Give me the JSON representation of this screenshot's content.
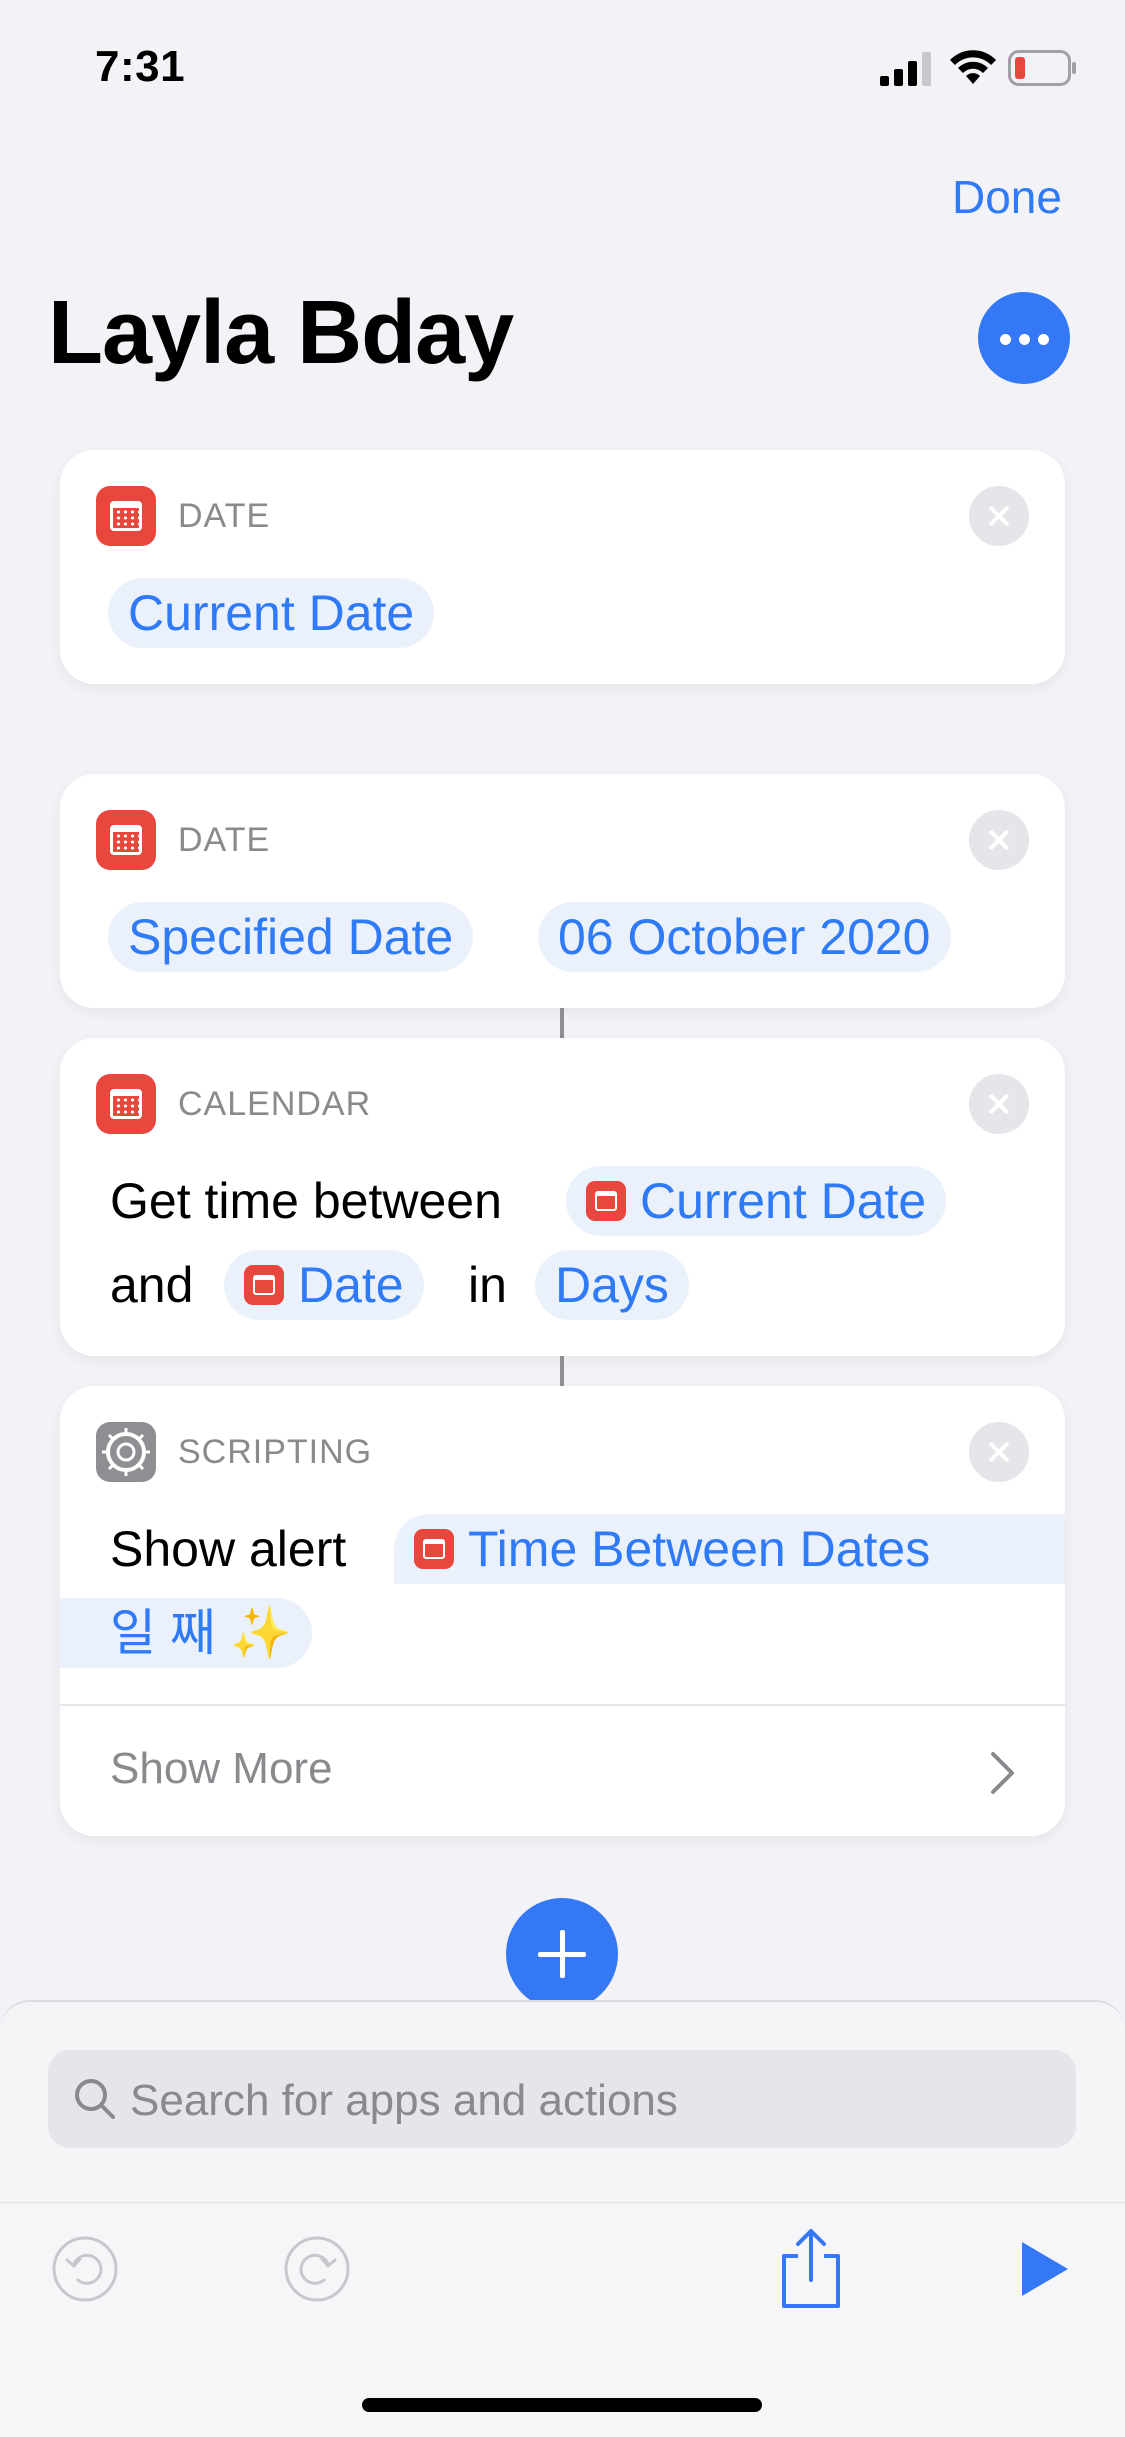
{
  "status_bar": {
    "time": "7:31"
  },
  "nav": {
    "done_label": "Done"
  },
  "shortcut": {
    "title": "Layla Bday"
  },
  "cards": {
    "date1": {
      "category": "DATE",
      "token": "Current Date"
    },
    "date2": {
      "category": "DATE",
      "token1": "Specified Date",
      "token2": "06 October 2020"
    },
    "calendar": {
      "category": "CALENDAR",
      "text1": "Get time between",
      "token1": "Current Date",
      "text2": "and",
      "token2": "Date",
      "text3": "in",
      "token3": "Days"
    },
    "scripting": {
      "category": "SCRIPTING",
      "text1": "Show alert",
      "token1": "Time Between Dates",
      "token2": "일 째 ✨",
      "show_more": "Show More"
    }
  },
  "search": {
    "placeholder": "Search for apps and actions"
  },
  "icons": {
    "signal": "signal-icon",
    "wifi": "wifi-icon",
    "battery": "battery-icon",
    "calendar": "calendar-icon",
    "gear": "gear-icon",
    "undo": "undo-icon",
    "redo": "redo-icon",
    "share": "share-icon",
    "play": "play-icon"
  },
  "colors": {
    "accent": "#3478f6",
    "calendar_red": "#e8473d",
    "battery_low": "#e8473d"
  }
}
